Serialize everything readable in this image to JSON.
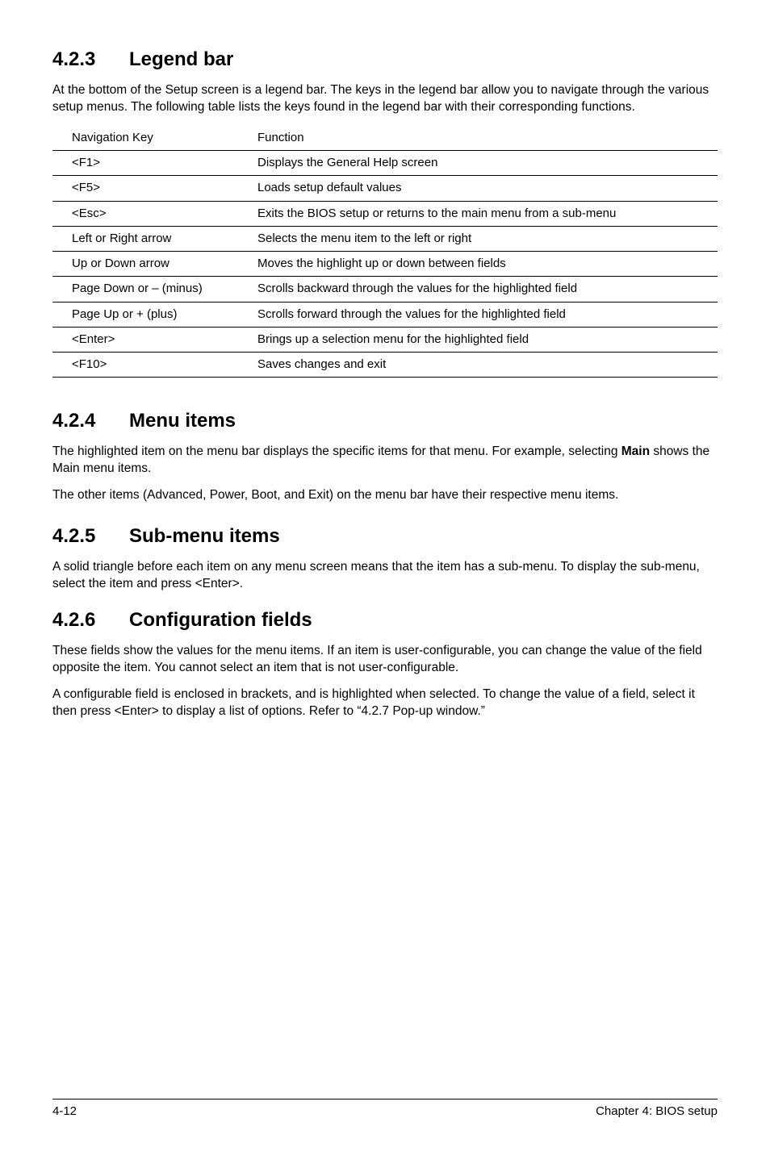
{
  "sections": {
    "s423": {
      "num": "4.2.3",
      "title": "Legend bar",
      "intro": "At the bottom of the Setup screen is a legend bar. The keys in the legend bar allow you to navigate through the various setup menus. The following table lists the keys found in the legend bar with their corresponding functions."
    },
    "table": {
      "head1": "Navigation Key",
      "head2": "Function",
      "rows": [
        {
          "k": "<F1>",
          "f": "Displays the General Help screen"
        },
        {
          "k": "<F5>",
          "f": "Loads setup default values"
        },
        {
          "k": "<Esc>",
          "f": "Exits the BIOS setup or returns to the main menu from a sub-menu"
        },
        {
          "k": "Left or Right arrow",
          "f": "Selects the menu item to the left or right"
        },
        {
          "k": "Up or Down arrow",
          "f": "Moves the highlight up or down between fields"
        },
        {
          "k": "Page Down or – (minus)",
          "f": "Scrolls backward through the values for the highlighted field"
        },
        {
          "k": "Page Up or + (plus)",
          "f": "Scrolls forward through the values for the highlighted field"
        },
        {
          "k": "<Enter>",
          "f": "Brings up a selection menu for the highlighted field"
        },
        {
          "k": "<F10>",
          "f": "Saves changes and exit"
        }
      ]
    },
    "s424": {
      "num": "4.2.4",
      "title": "Menu items",
      "p1a": "The highlighted item on the menu bar  displays the specific items for that menu. For example, selecting ",
      "p1b": "Main",
      "p1c": " shows the Main menu items.",
      "p2": "The other items (Advanced, Power, Boot, and Exit) on the menu bar have their respective menu items."
    },
    "s425": {
      "num": "4.2.5",
      "title": "Sub-menu items",
      "p1": "A solid triangle before each item on any menu screen means that the item has a sub-menu. To display the sub-menu, select the item and press <Enter>."
    },
    "s426": {
      "num": "4.2.6",
      "title": "Configuration fields",
      "p1": "These fields show the values for the menu items. If an item is user-configurable, you can change the value of the field opposite the item. You cannot select an item that is not user-configurable.",
      "p2": "A configurable field is enclosed in brackets, and is highlighted when selected. To change the value of a field, select it then press <Enter> to display a list of options. Refer to “4.2.7 Pop-up window.”"
    }
  },
  "footer": {
    "left": "4-12",
    "right": "Chapter 4: BIOS setup"
  }
}
